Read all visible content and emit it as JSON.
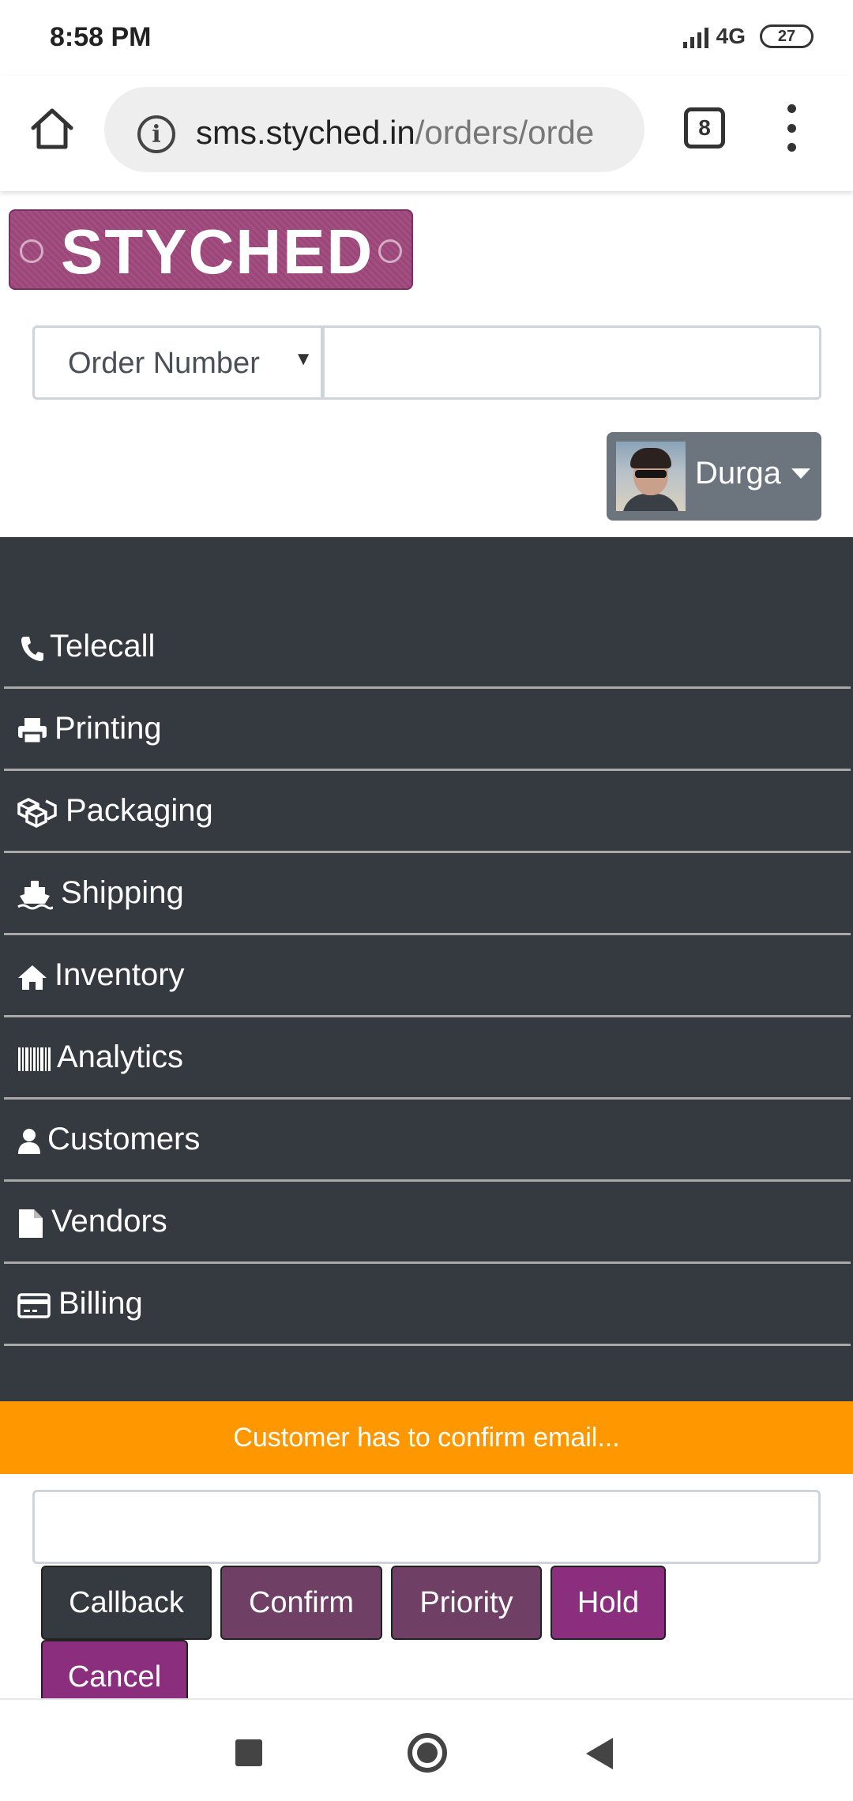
{
  "status_bar": {
    "time": "8:58 PM",
    "network": "4G",
    "battery": "27"
  },
  "browser": {
    "url_host": "sms.styched.in",
    "url_path": "/orders/orde",
    "tab_count": "8"
  },
  "app": {
    "logo_text": "STYCHED"
  },
  "search": {
    "select_label": "Order Number",
    "input_value": ""
  },
  "user": {
    "name": "Durga"
  },
  "sidebar": {
    "items": [
      {
        "label": "Telecall",
        "icon": "phone-icon"
      },
      {
        "label": "Printing",
        "icon": "printer-icon"
      },
      {
        "label": "Packaging",
        "icon": "boxes-icon"
      },
      {
        "label": "Shipping",
        "icon": "ship-icon"
      },
      {
        "label": "Inventory",
        "icon": "home-icon"
      },
      {
        "label": "Analytics",
        "icon": "barcode-icon"
      },
      {
        "label": "Customers",
        "icon": "user-icon"
      },
      {
        "label": "Vendors",
        "icon": "file-icon"
      },
      {
        "label": "Billing",
        "icon": "credit-card-icon"
      }
    ]
  },
  "alert": {
    "text": "Customer has to confirm email..."
  },
  "actions": {
    "note_value": "",
    "callback": "Callback",
    "confirm": "Confirm",
    "priority": "Priority",
    "hold": "Hold",
    "cancel": "Cancel"
  },
  "colors": {
    "sidebar": "#343a40",
    "alert": "#ff9800",
    "brand": "#9b4679",
    "hold": "#8b2e7e",
    "confirm": "#6f3f66"
  }
}
